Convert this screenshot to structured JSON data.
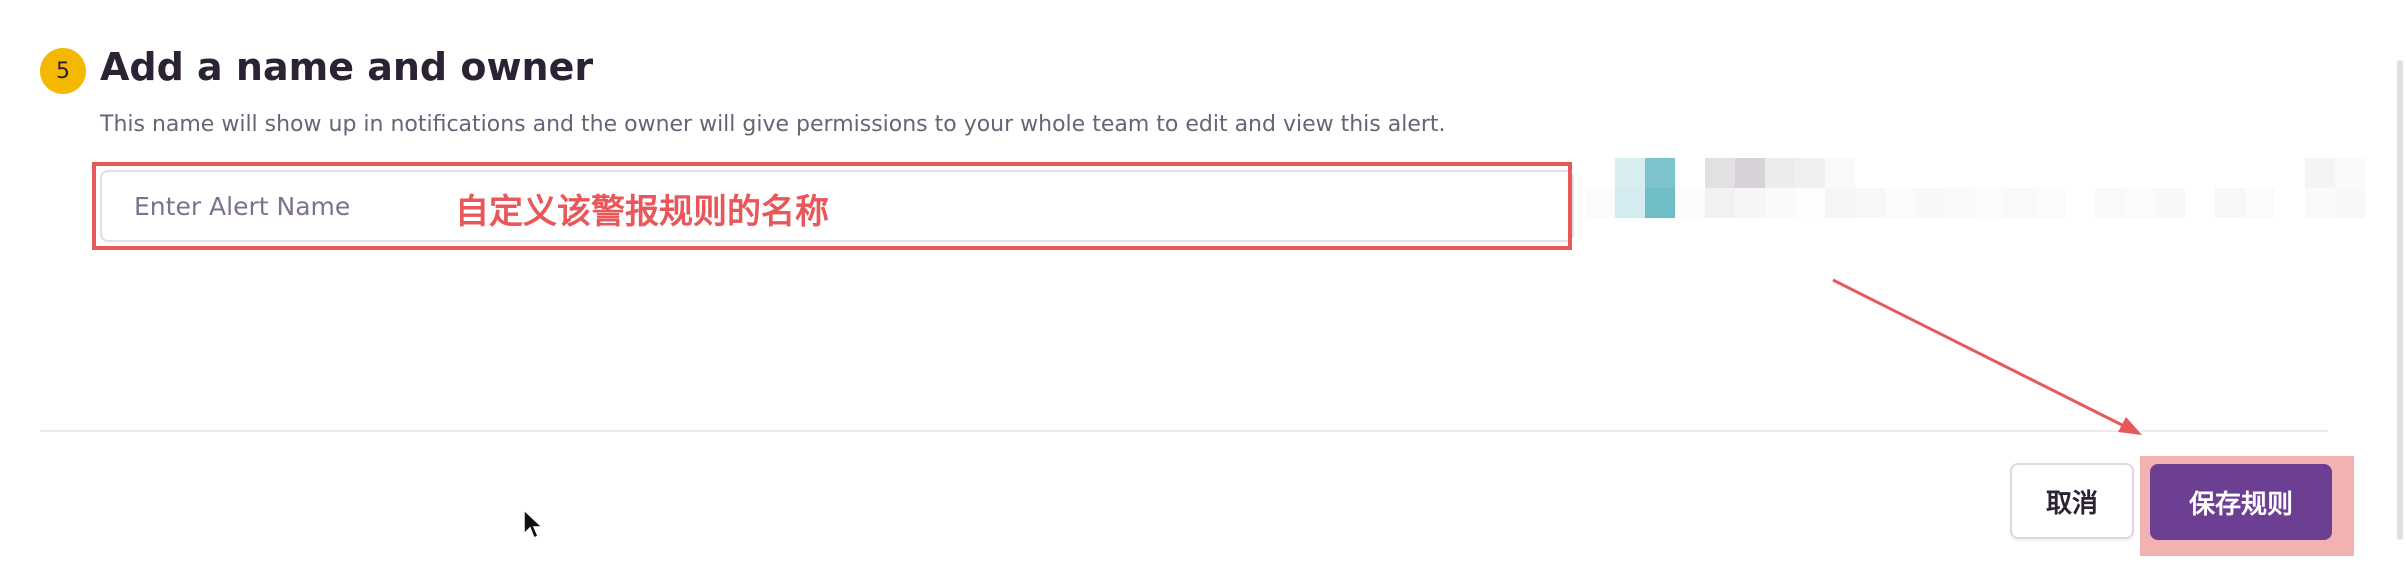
{
  "step": {
    "number": "5",
    "title": "Add a name and owner",
    "description": "This name will show up in notifications and the owner will give permissions to your whole team to edit and view this alert."
  },
  "alert_name_input": {
    "value": "",
    "placeholder": "Enter Alert Name"
  },
  "annotation": {
    "text": "自定义该警报规则的名称",
    "color": "#e8585a"
  },
  "owner_selector": {
    "state": "pixelated"
  },
  "footer": {
    "cancel_label": "取消",
    "save_label": "保存规则"
  },
  "colors": {
    "accent": "#6c3f93",
    "step_badge": "#f5b800",
    "annotation_red": "#e8585a"
  }
}
